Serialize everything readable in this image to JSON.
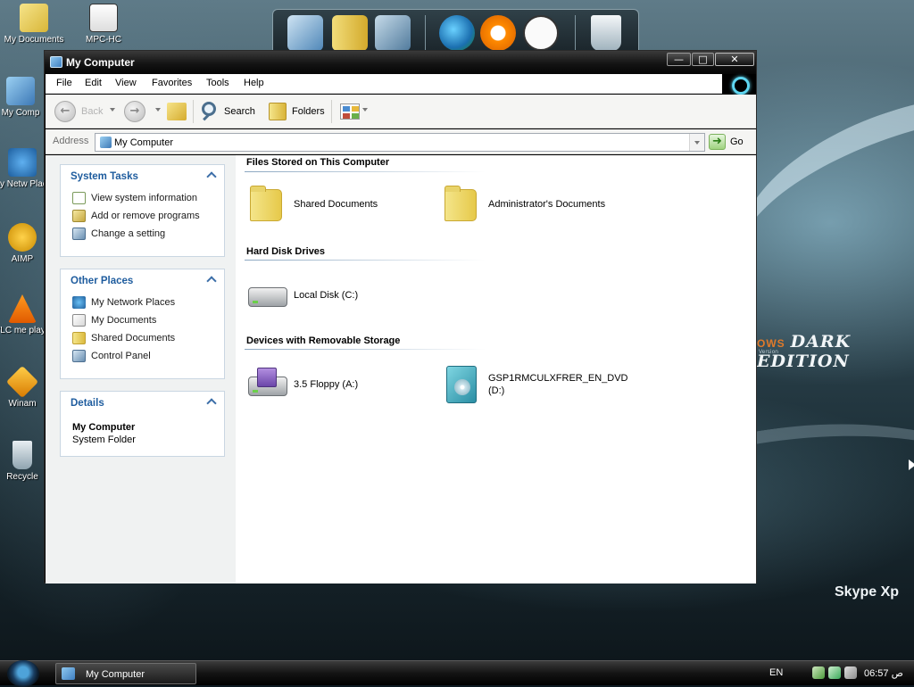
{
  "desktop": {
    "icons": [
      {
        "label": "My Documents"
      },
      {
        "label": "MPC-HC"
      },
      {
        "label": "My Comp"
      },
      {
        "label": "My Netw Place"
      },
      {
        "label": "AIMP"
      },
      {
        "label": "VLC me playe"
      },
      {
        "label": "Winam"
      },
      {
        "label": "Recycle"
      }
    ],
    "wallpaper_text": "DARK EDITION",
    "wallpaper_prefix": "OWS",
    "wallpaper_version": "Version",
    "skype_text": "Skype Xp"
  },
  "window": {
    "title": "My Computer",
    "caption_buttons": {
      "minimize": "—",
      "maximize": "□",
      "close": "✕"
    },
    "menu": [
      "File",
      "Edit",
      "View",
      "Favorites",
      "Tools",
      "Help"
    ],
    "toolbar": {
      "back_label": "Back",
      "search_label": "Search",
      "folders_label": "Folders"
    },
    "address": {
      "label": "Address",
      "value": "My Computer",
      "go_label": "Go"
    }
  },
  "taskpane": {
    "system_tasks": {
      "title": "System Tasks",
      "items": [
        {
          "label": "View system information",
          "icon": "info-icon"
        },
        {
          "label": "Add or remove programs",
          "icon": "programs-icon"
        },
        {
          "label": "Change a setting",
          "icon": "control-panel-icon"
        }
      ]
    },
    "other_places": {
      "title": "Other Places",
      "items": [
        {
          "label": "My Network Places",
          "icon": "network-icon"
        },
        {
          "label": "My Documents",
          "icon": "documents-icon"
        },
        {
          "label": "Shared Documents",
          "icon": "folder-icon"
        },
        {
          "label": "Control Panel",
          "icon": "control-panel-icon"
        }
      ]
    },
    "details": {
      "title": "Details",
      "name": "My Computer",
      "type": "System Folder"
    }
  },
  "content": {
    "groups": [
      {
        "title": "Files Stored on This Computer",
        "items": [
          {
            "name": "Shared Documents",
            "icon": "folder-icon"
          },
          {
            "name": "Administrator's Documents",
            "icon": "folder-icon"
          }
        ]
      },
      {
        "title": "Hard Disk Drives",
        "items": [
          {
            "name": "Local Disk (C:)",
            "icon": "hard-disk-icon"
          }
        ]
      },
      {
        "title": "Devices with Removable Storage",
        "items": [
          {
            "name": "3.5 Floppy (A:)",
            "icon": "floppy-drive-icon"
          },
          {
            "name_line1": "GSP1RMCULXFRER_EN_DVD",
            "name_line2": "(D:)",
            "icon": "dvd-drive-icon"
          }
        ]
      }
    ]
  },
  "taskbar": {
    "task_label": "My Computer",
    "language": "EN",
    "clock": "06:57 ص"
  },
  "colors": {
    "link_blue": "#1e5c9e",
    "panel_border": "#c9d6e2",
    "titlebar": "#141414"
  }
}
